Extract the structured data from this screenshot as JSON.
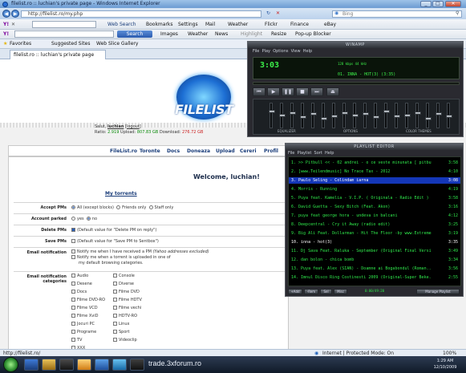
{
  "browser": {
    "title": "filelist.ro :: luchian's private page - Windows Internet Explorer",
    "address": "http://filelist.ro/my.php",
    "bing_placeholder": "Bing",
    "tab_title": "filelist.ro :: luchian's private page",
    "status_url": "http://filelist.ro/",
    "status_zone": "Internet | Protected Mode: On",
    "zoom": "100%"
  },
  "toolbar1": {
    "web_search": "Web Search",
    "bookmarks": "Bookmarks",
    "settings": "Settings",
    "mail": "Mail",
    "weather": "Weather",
    "flickr": "Flickr",
    "finance": "Finance",
    "ebay": "eBay"
  },
  "toolbar2": {
    "search": "Search",
    "images": "Images",
    "weather": "Weather",
    "news": "News",
    "highlight": "Highlight",
    "resize": "Resize",
    "popup": "Pop-up Blocker"
  },
  "favbar": {
    "favorites": "Favorites",
    "suggested": "Suggested Sites",
    "webslice": "Web Slice Gallery"
  },
  "site": {
    "logo": "FILELIST",
    "user_greeting": "Salut,",
    "username": "luchian",
    "logout": "logout",
    "ratio_label": "Ratio:",
    "ratio": "2.919",
    "upload_label": "Upload:",
    "upload": "807.83 GB",
    "download_label": "Download:",
    "download": "276.72 GB",
    "nav": [
      "FileList.ro",
      "Toronte",
      "Docs",
      "Doneaza",
      "Upload",
      "Cereri",
      "Profil"
    ],
    "welcome": "Welcome, luchian!",
    "my_torrents": "My torrents"
  },
  "form": {
    "accept_pms": {
      "label": "Accept PMs",
      "options": [
        "All (except blocks)",
        "Friends only",
        "Staff only"
      ]
    },
    "account_parked": {
      "label": "Account parked",
      "options": [
        "yes",
        "no"
      ]
    },
    "delete_pms": {
      "label": "Delete PMs",
      "value": "(Default value for \"Delete PM on reply\")"
    },
    "save_pms": {
      "label": "Save PMs",
      "value": "(Default value for \"Save PM to Sentbox\")"
    },
    "email_notification": {
      "label": "Email notification",
      "opt1": "Notify me when I have received a PM",
      "opt1b": "(Yahoo addresses excluded)",
      "opt2": "Notify me when a torrent is uploaded in one of",
      "opt2b": "my default browsing categories."
    },
    "email_categories": {
      "label": "Email notification categories",
      "col1": [
        "Audio",
        "Desene",
        "Docs",
        "Filme DVD-RO",
        "Filme VCD",
        "Filme XviD",
        "Jocuri PC",
        "Programe",
        "TV",
        "XXX"
      ],
      "col2": [
        "Console",
        "Diverse",
        "Filme DVD",
        "Filme HDTV",
        "Filme vechi",
        "HDTV-RO",
        "Linux",
        "Sport",
        "Videoclip"
      ]
    }
  },
  "winamp": {
    "title": "WINAMP",
    "menu": [
      "File",
      "Play",
      "Options",
      "View",
      "Help"
    ],
    "time": "3:03",
    "kbps": "128 kbps  44 kHz",
    "song": "01. INNA - HOT(3) (3:35)",
    "eq_labels": [
      "EQUALIZER",
      "OPTIONS",
      "COLOR THEMES"
    ],
    "eq_knob_levels": [
      0.3,
      0.45,
      0.35,
      0.55,
      0.4,
      0.6,
      0.5,
      0.35,
      0.45,
      0.4,
      0.55,
      0.3,
      0.5,
      0.45,
      0.35,
      0.6,
      0.4,
      0.5
    ],
    "playlist_title": "PLAYLIST EDITOR",
    "playlist_menu": [
      "File",
      "Playlist",
      "Sort",
      "Help"
    ],
    "playlist": [
      {
        "t": "1. >> Pitbull << - 02 andrei - o ce veste minunata [ pitbull &w...",
        "d": "3:58"
      },
      {
        "t": "2. [www.Teilendmusic] No Trace Tax - 2012",
        "d": "4:10"
      },
      {
        "t": "3. Paulo Seling - Colindam iarna",
        "d": "3:08"
      },
      {
        "t": "4. Morris - Running",
        "d": "4:19"
      },
      {
        "t": "5. Puya feat. Kamelia - V.I.P. ( Originala - Radio Edit )",
        "d": "3:58"
      },
      {
        "t": "6. David Guetta - Sexy Bitch (Feat. Akon)",
        "d": "3:16"
      },
      {
        "t": "7. puya feat george hora - undeva in balcani",
        "d": "4:12"
      },
      {
        "t": "8. Deepcentral - Cry it Away (radio edit)",
        "d": "3:25"
      },
      {
        "t": "9. Big Ali Feat. Dollarman - Hit The Floor -by www.Extreme...",
        "d": "3:19"
      },
      {
        "t": "10. inna - hot(3)",
        "d": "3:35"
      },
      {
        "t": "11. Dj Sava Feat. Raluka - September (Original Final Version...",
        "d": "3:49"
      },
      {
        "t": "12. dan bolon - chica bomb",
        "d": "3:34"
      },
      {
        "t": "13. Puya feat. Alex (SIAN) - Doamne ai Bogabondul (Roman...",
        "d": "3:56"
      },
      {
        "t": "14. Imnul Disco Ring Costinesti 2009 (Original-Super Beke...",
        "d": "2:55"
      }
    ],
    "playlist_buttons": [
      "+Add",
      "-Rem",
      "Sel",
      "Misc"
    ],
    "playlist_total": "0:00/49:20",
    "manage": "Manage Playlist"
  },
  "taskbar": {
    "forum": "trade.3xforum.ro",
    "time": "1:29 AM",
    "date": "12/10/2009"
  }
}
